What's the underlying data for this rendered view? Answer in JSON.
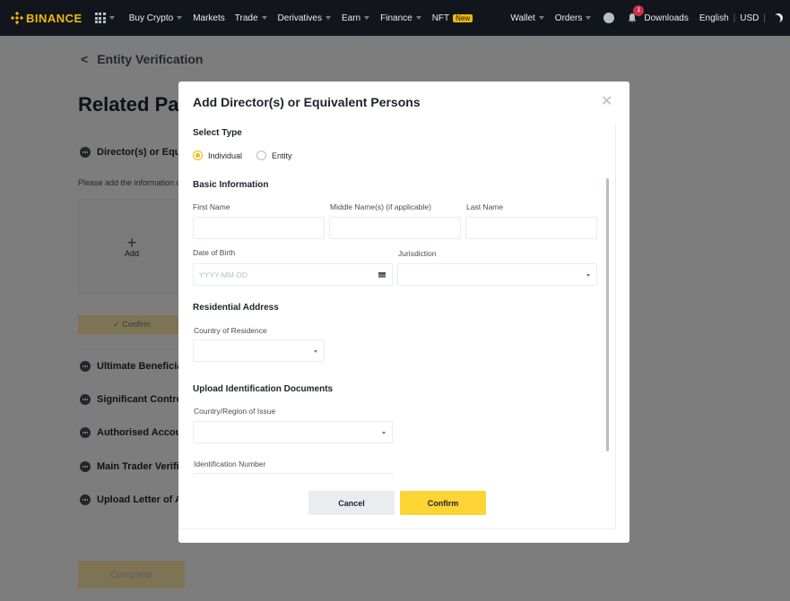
{
  "nav": {
    "brand": "BINANCE",
    "items": [
      "Buy Crypto",
      "Markets",
      "Trade",
      "Derivatives",
      "Earn",
      "Finance",
      "NFT"
    ],
    "new_badge": "New",
    "wallet": "Wallet",
    "orders": "Orders",
    "notifications_count": "1",
    "downloads": "Downloads",
    "language": "English",
    "currency": "USD",
    "separator": "|"
  },
  "page": {
    "back_label": "Entity Verification",
    "title": "Related Parties",
    "steps": [
      "Director(s) or Equivalent Persons",
      "Ultimate Beneficial Owners",
      "Significant Controllers",
      "Authorised Account Users",
      "Main Trader Verification",
      "Upload Letter of Authorisation"
    ],
    "hint": "Please add the information of all directors or equivalent persons",
    "add_label": "Add",
    "confirm_label": "✓ Confirm",
    "complete_label": "Complete"
  },
  "modal": {
    "title": "Add Director(s) or Equivalent Persons",
    "close": "✕",
    "select_type": "Select Type",
    "types": [
      {
        "label": "Individual",
        "selected": true
      },
      {
        "label": "Entity",
        "selected": false
      }
    ],
    "basic_info": "Basic Information",
    "first_name": "First Name",
    "middle_name": "Middle Name(s) (if applicable)",
    "last_name": "Last Name",
    "dob": "Date of Birth",
    "dob_placeholder": "YYYY-MM-DD",
    "jurisdiction": "Jurisdiction",
    "residential": "Residential Address",
    "country_residence": "Country of Residence",
    "upload_docs": "Upload Identification Documents",
    "country_issue": "Country/Region of Issue",
    "id_number": "Identification Number",
    "cancel": "Cancel",
    "confirm": "Confirm"
  }
}
